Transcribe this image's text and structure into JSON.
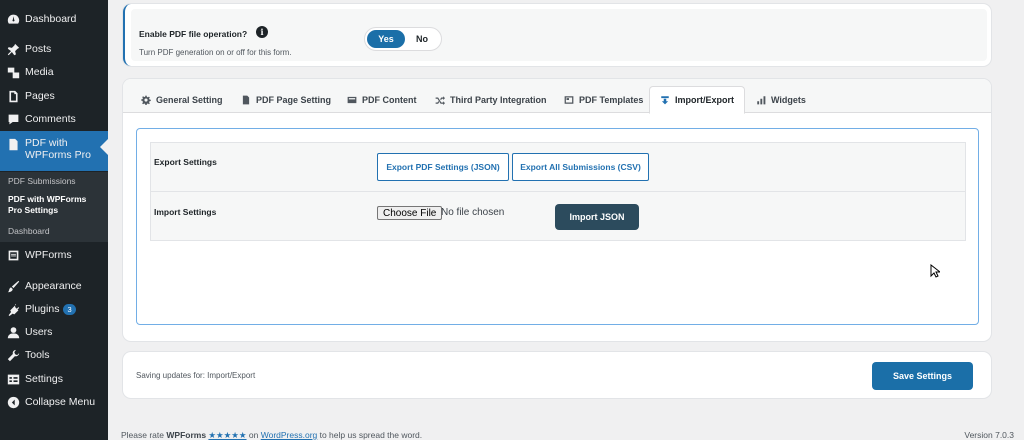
{
  "sidebar": {
    "items": [
      {
        "label": "Dashboard",
        "icon": "dashboard-icon"
      },
      {
        "label": "Posts",
        "icon": "pin-icon"
      },
      {
        "label": "Media",
        "icon": "media-icon"
      },
      {
        "label": "Pages",
        "icon": "page-icon"
      },
      {
        "label": "Comments",
        "icon": "comment-icon"
      },
      {
        "label": "PDF with WPForms Pro",
        "icon": "document-icon"
      },
      {
        "label": "WPForms",
        "icon": "wpforms-icon"
      },
      {
        "label": "Appearance",
        "icon": "brush-icon"
      },
      {
        "label": "Plugins",
        "icon": "plugin-icon",
        "badge": "3"
      },
      {
        "label": "Users",
        "icon": "user-icon"
      },
      {
        "label": "Tools",
        "icon": "wrench-icon"
      },
      {
        "label": "Settings",
        "icon": "settings-icon"
      },
      {
        "label": "Collapse Menu",
        "icon": "collapse-icon"
      }
    ],
    "submenu": [
      {
        "label": "PDF Submissions"
      },
      {
        "label": "PDF with WPForms Pro Settings"
      },
      {
        "label": "Dashboard"
      }
    ]
  },
  "top": {
    "title": "Enable PDF file operation?",
    "info_glyph": "i",
    "description": "Turn PDF generation on or off for this form.",
    "toggle_yes": "Yes",
    "toggle_no": "No"
  },
  "tabs": [
    {
      "label": "General Setting",
      "icon": "gear-icon"
    },
    {
      "label": "PDF Page Setting",
      "icon": "page-setting-icon"
    },
    {
      "label": "PDF Content",
      "icon": "content-icon"
    },
    {
      "label": "Third Party Integration",
      "icon": "shuffle-icon"
    },
    {
      "label": "PDF Templates",
      "icon": "template-icon"
    },
    {
      "label": "Import/Export",
      "icon": "import-export-icon",
      "active": true
    },
    {
      "label": "Widgets",
      "icon": "bar-chart-icon"
    }
  ],
  "export": {
    "label": "Export Settings",
    "btn_json": "Export PDF Settings (JSON)",
    "btn_csv": "Export All Submissions (CSV)"
  },
  "import": {
    "label": "Import Settings",
    "choose_file": "Choose File",
    "file_status": "No file chosen",
    "btn_import": "Import JSON"
  },
  "save": {
    "text": "Saving updates for: Import/Export",
    "button": "Save Settings"
  },
  "footer": {
    "prefix": "Please rate ",
    "brand": "WPForms",
    "stars": "★★★★★",
    "on": " on ",
    "link": "WordPress.org",
    "suffix": " to help us spread the word.",
    "version": "Version 7.0.3"
  },
  "colors": {
    "accent": "#2271b1",
    "sidebar_bg": "#1d2327",
    "import_button": "#2c4b5d"
  }
}
